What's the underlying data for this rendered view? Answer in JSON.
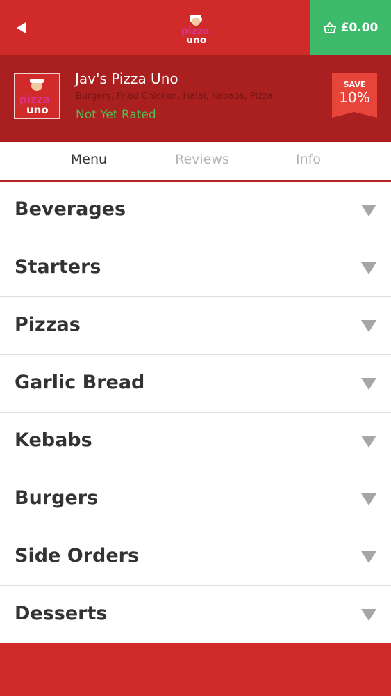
{
  "header": {
    "back_icon": "back-arrow-icon",
    "logo_icon": "pizza-uno-logo",
    "basket_icon": "basket-icon",
    "basket_total": "£0.00"
  },
  "restaurant": {
    "name": "Jav's Pizza Uno",
    "cuisines": "Burgers, Fried Chicken, Halal, Kebabs, Pizza",
    "rating": "Not Yet Rated",
    "save_label": "SAVE",
    "save_value": "10%"
  },
  "tabs": [
    {
      "label": "Menu",
      "active": true
    },
    {
      "label": "Reviews",
      "active": false
    },
    {
      "label": "Info",
      "active": false
    }
  ],
  "menu": {
    "categories": [
      {
        "label": "Beverages"
      },
      {
        "label": "Starters"
      },
      {
        "label": "Pizzas"
      },
      {
        "label": "Garlic Bread"
      },
      {
        "label": "Kebabs"
      },
      {
        "label": "Burgers"
      },
      {
        "label": "Side Orders"
      },
      {
        "label": "Desserts"
      }
    ],
    "expand_icon": "chevron-down-icon"
  },
  "colors": {
    "brand_red": "#d12a2a",
    "dark_red": "#aa1f1f",
    "basket_green": "#3dbb6b",
    "rating_green": "#4fbf55"
  }
}
